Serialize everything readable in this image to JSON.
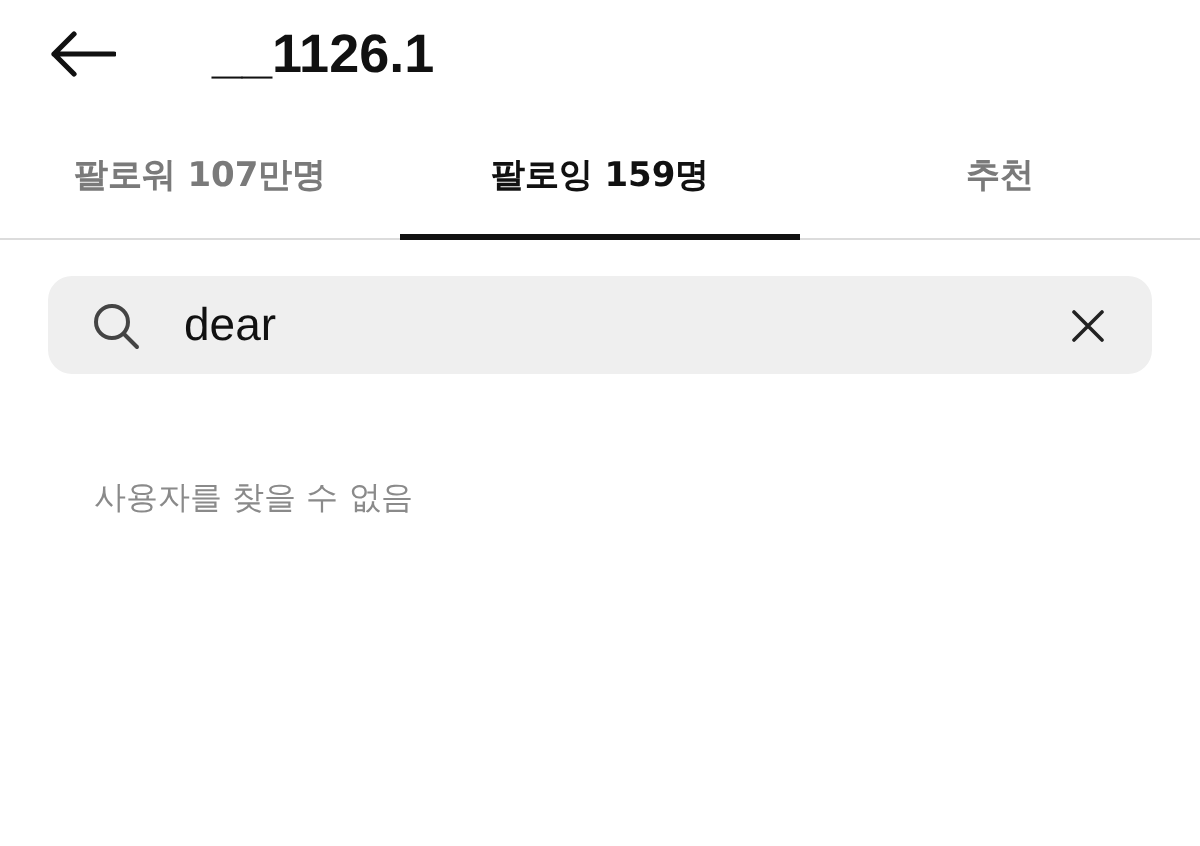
{
  "header": {
    "title": "__1126.1"
  },
  "tabs": [
    {
      "label": "팔로워 107만명",
      "selected": false
    },
    {
      "label": "팔로잉 159명",
      "selected": true
    },
    {
      "label": "추천",
      "selected": false
    }
  ],
  "search": {
    "value": "dear"
  },
  "empty_message": "사용자를 찾을 수 없음"
}
